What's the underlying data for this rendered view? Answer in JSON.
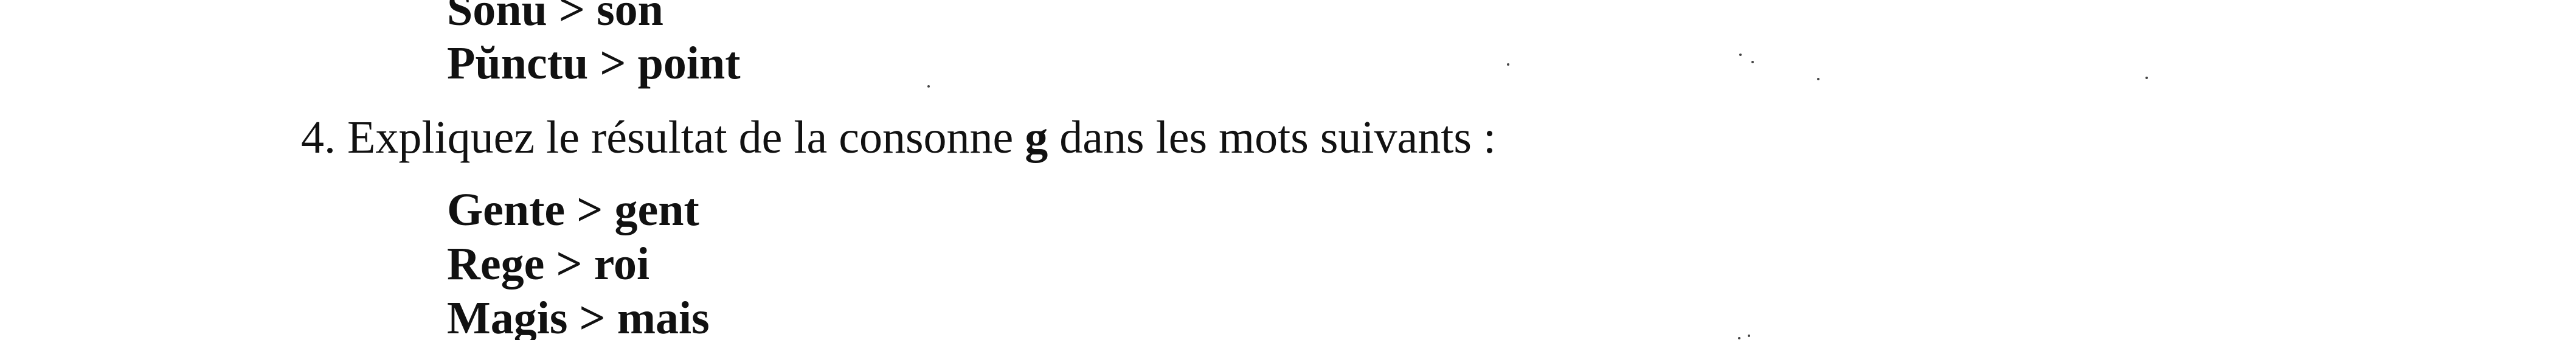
{
  "document": {
    "top_examples": [
      "Sonu > son",
      "Pŭnctu > point"
    ],
    "question": {
      "number": "4.",
      "text_before": "Expliquez le résultat de la consonne ",
      "highlight": "g",
      "text_after": " dans les mots suivants :"
    },
    "bottom_examples": [
      "Gente > gent",
      "Rege > roi",
      "Magis > mais"
    ]
  }
}
